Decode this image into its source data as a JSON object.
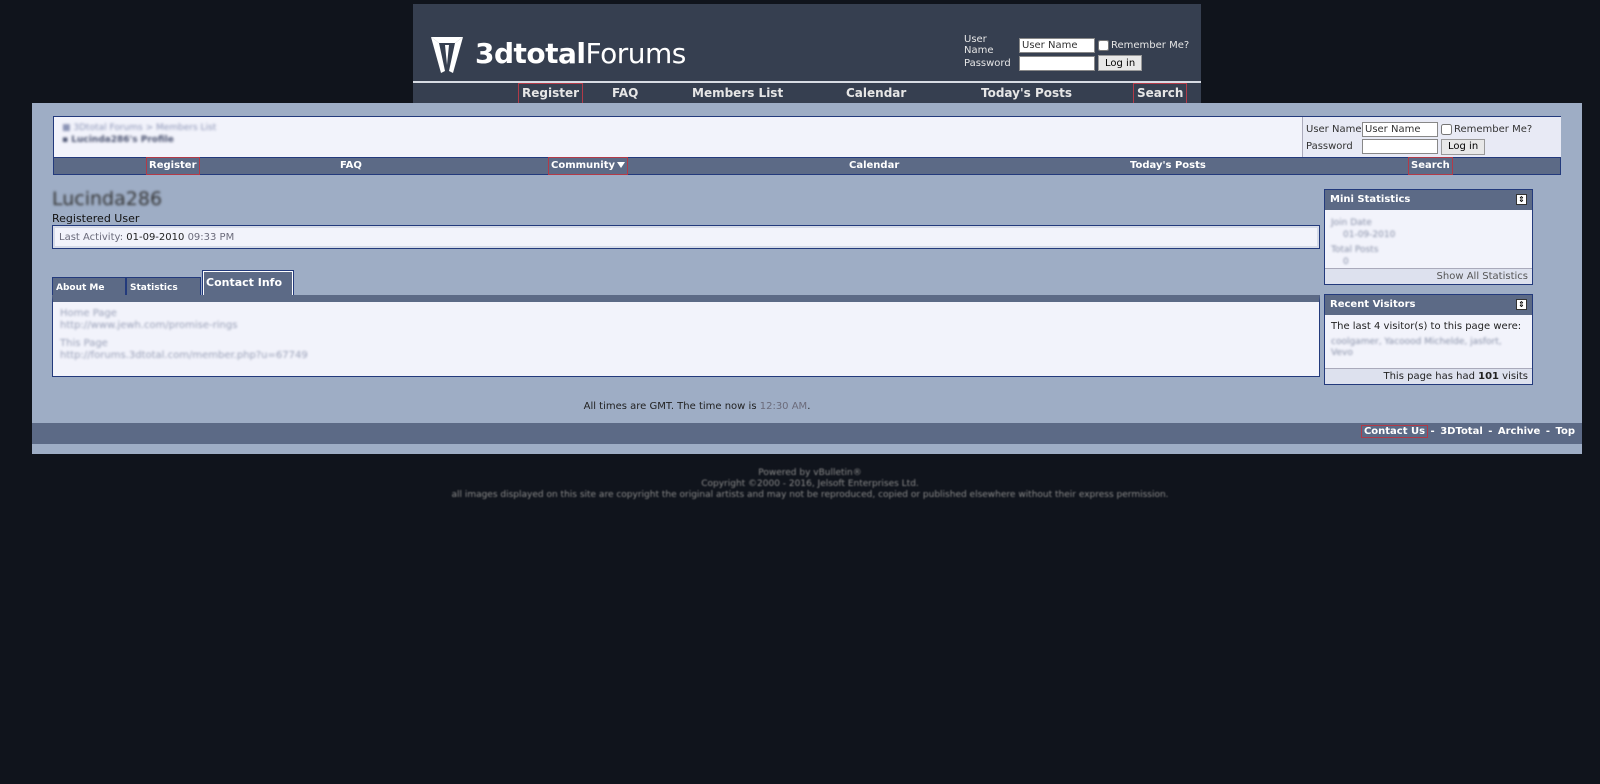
{
  "header": {
    "logo_bold": "3dtotal",
    "logo_light": "Forums",
    "login": {
      "username_label": "User Name",
      "username_value": "User Name",
      "remember_label": "Remember Me?",
      "password_label": "Password",
      "login_button": "Log in"
    },
    "nav": [
      "Register",
      "FAQ",
      "Members List",
      "Calendar",
      "Today's Posts",
      "Search"
    ]
  },
  "subheader": {
    "breadcrumb_trail": "3Dtotal Forums > Members List",
    "breadcrumb_current": "Lucinda286's Profile",
    "login": {
      "username_label": "User Name",
      "username_value": "User Name",
      "remember_label": "Remember Me?",
      "password_label": "Password",
      "login_button": "Log in"
    },
    "nav": [
      "Register",
      "FAQ",
      "Community",
      "Calendar",
      "Today's Posts",
      "Search"
    ]
  },
  "profile": {
    "username": "Lucinda286",
    "user_title": "Registered User",
    "activity_label": "Last Activity",
    "activity_date": "01-09-2010",
    "activity_time": "09:33 PM",
    "tabs": [
      "About Me",
      "Statistics",
      "Contact Info"
    ],
    "contact": [
      {
        "label": "Home Page",
        "value": "http://www.jewh.com/promise-rings"
      },
      {
        "label": "This Page",
        "value": "http://forums.3dtotal.com/member.php?u=67749"
      }
    ]
  },
  "sidebar": {
    "mini_stats": {
      "title": "Mini Statistics",
      "join_label": "Join Date",
      "join_value": "01-09-2010",
      "posts_label": "Total Posts",
      "posts_value": "0",
      "footer": "Show All Statistics"
    },
    "recent_visitors": {
      "title": "Recent Visitors",
      "intro": "The last 4 visitor(s) to this page were:",
      "names": "coolgamer, Yacoood Michelde, jasfort, Vevo",
      "footer_prefix": "This page has had",
      "visits": "101",
      "footer_suffix": "visits"
    }
  },
  "footer": {
    "time_prefix": "All times are GMT. The time now is",
    "time_now": "12:30 AM",
    "links": [
      "Contact Us",
      "3DTotal",
      "Archive",
      "Top"
    ],
    "powered": "Powered by vBulletin®",
    "copyright": "Copyright ©2000 - 2016, Jelsoft Enterprises Ltd.",
    "notice": "all images displayed on this site are copyright the original artists and may not be reproduced, copied or published elsewhere without their express permission."
  },
  "colors": {
    "page_bg": "#10141c",
    "header_bg": "#363f50",
    "panel_bg": "#9eadc5",
    "nav_bg": "#5c6a86",
    "border": "#233a7c",
    "highlight": "#b23a48"
  }
}
